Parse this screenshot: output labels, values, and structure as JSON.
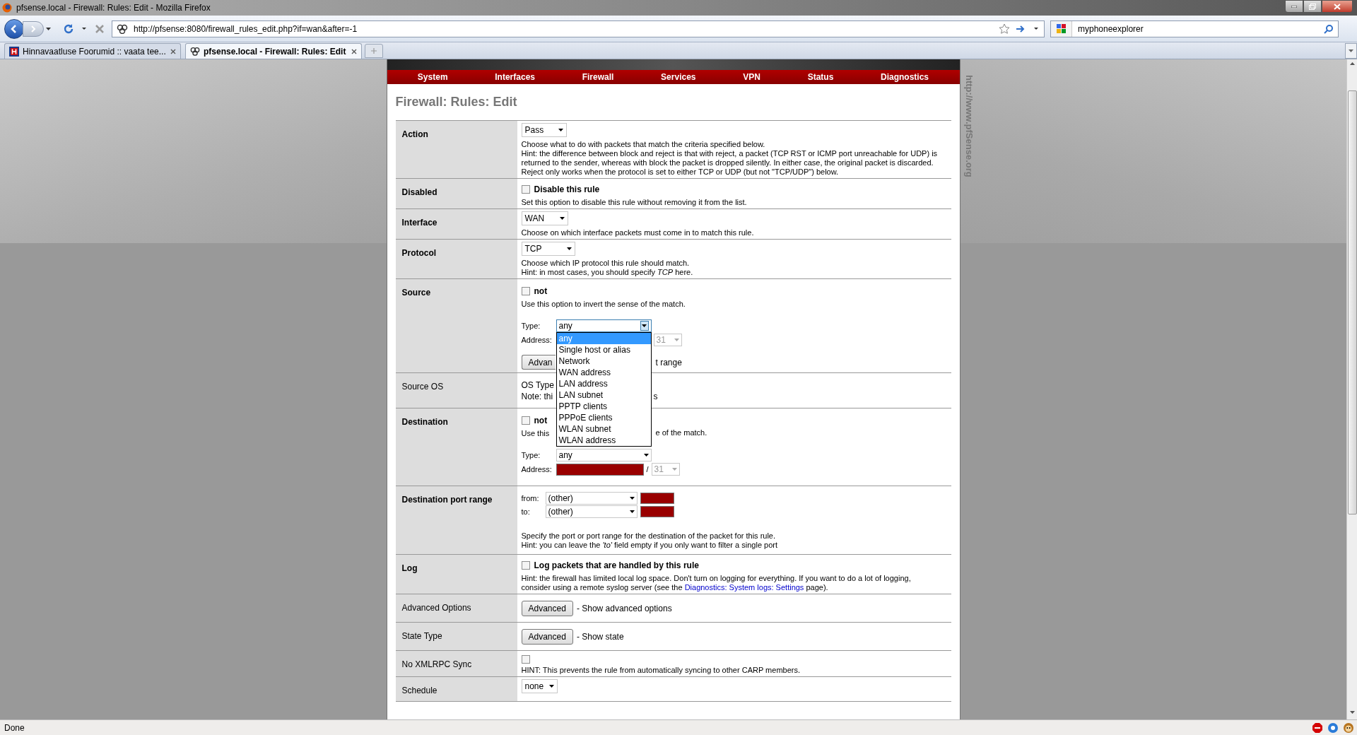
{
  "window": {
    "title": "pfsense.local - Firewall: Rules: Edit - Mozilla Firefox"
  },
  "toolbar": {
    "url": "http://pfsense:8080/firewall_rules_edit.php?if=wan&after=-1",
    "search": "myphoneexplorer"
  },
  "tabs": [
    {
      "label": "Hinnavaatluse Foorumid :: vaata tee...",
      "selected": false
    },
    {
      "label": "pfsense.local - Firewall: Rules: Edit",
      "selected": true
    }
  ],
  "page": {
    "nav": [
      "System",
      "Interfaces",
      "Firewall",
      "Services",
      "VPN",
      "Status",
      "Diagnostics"
    ],
    "side_text": "http://www.pfSense.org",
    "title": "Firewall: Rules: Edit",
    "rows": [
      {
        "kind": "select",
        "label": "Action",
        "bold": true,
        "select": "Pass",
        "text": [
          "Choose what to do with packets that match the criteria specified below.",
          "Hint: the difference between block and reject is that with reject, a packet (TCP RST or ICMP port unreachable for UDP) is",
          "returned to the sender, whereas with block the packet is dropped silently. In either case, the original packet is discarded.",
          "Reject only works when the protocol is set to either TCP or UDP (but not \"TCP/UDP\") below."
        ]
      },
      {
        "kind": "checkbox",
        "label": "Disabled",
        "bold": true,
        "checkbox": {
          "label": "Disable this rule",
          "checked": false
        },
        "text": [
          "Set this option to disable this rule without removing it from the list."
        ]
      },
      {
        "kind": "select",
        "label": "Interface",
        "bold": true,
        "select": "WAN",
        "text": [
          "Choose on which interface packets must come in to match this rule."
        ]
      },
      {
        "kind": "select",
        "label": "Protocol",
        "bold": true,
        "select": "TCP",
        "text": [
          "Choose which IP protocol this rule should match.",
          "Hint: in most cases, you should specify *TCP* here."
        ]
      },
      {
        "kind": "address",
        "label": "Source",
        "bold": true,
        "checkbox": {
          "label": "not",
          "checked": false
        },
        "hint": [
          "Use this option to invert the sense of the match."
        ],
        "type_label": "Type:",
        "type_value": "any",
        "address_label": "Address:",
        "mask": "31",
        "button": "Advan",
        "button_note": "t range",
        "dropdown": [
          {
            "label": "any",
            "selected": true
          },
          {
            "label": "Single host or alias",
            "selected": false
          },
          {
            "label": "Network",
            "selected": false
          },
          {
            "label": "WAN address",
            "selected": false
          },
          {
            "label": "LAN address",
            "selected": false
          },
          {
            "label": "LAN subnet",
            "selected": false
          },
          {
            "label": "PPTP clients",
            "selected": false
          },
          {
            "label": "PPPoE clients",
            "selected": false
          },
          {
            "label": "WLAN subnet",
            "selected": false
          },
          {
            "label": "WLAN address",
            "selected": false
          }
        ]
      },
      {
        "kind": "fragments",
        "label": "Source OS",
        "bold": false,
        "lines": [
          [
            "OS Type"
          ],
          [
            "Note: thi",
            "s"
          ]
        ]
      },
      {
        "kind": "address",
        "label": "Destination",
        "bold": true,
        "checkbox": {
          "label": "not",
          "checked": false
        },
        "hint": [
          "Use this",
          "e of the match."
        ],
        "type_label": "Type:",
        "type_value": "any",
        "address_label": "Address:",
        "separator": "/",
        "mask": "31"
      },
      {
        "kind": "ports",
        "label": "Destination port range",
        "bold": true,
        "ports": [
          {
            "label": "from:",
            "value": "(other)"
          },
          {
            "label": "to:",
            "value": "(other)"
          }
        ],
        "text": [
          "Specify the port or port range for the destination of the packet for this rule.",
          "Hint: you can leave the *'to'* field empty if you only want to filter a single port"
        ]
      },
      {
        "kind": "checkbox",
        "label": "Log",
        "bold": true,
        "checkbox": {
          "label": "Log packets that are handled by this rule",
          "checked": false
        },
        "text": [
          "Hint: the firewall has limited local log space. Don't turn on logging for everything. If you want to do a lot of logging,"
        ],
        "link_line": {
          "before": "consider using a remote syslog server (see the",
          "link": "Diagnostics: System logs: Settings",
          "after": "page)."
        }
      },
      {
        "kind": "button",
        "label": "Advanced Options",
        "bold": false,
        "button": "Advanced",
        "note": "- Show advanced options"
      },
      {
        "kind": "button",
        "label": "State Type",
        "bold": false,
        "button": "Advanced",
        "note": "- Show state"
      },
      {
        "kind": "checkbox",
        "label": "No XMLRPC Sync",
        "bold": false,
        "checkbox": {
          "checked": false
        },
        "text": [
          "HINT: This prevents the rule from automatically syncing to other CARP members."
        ]
      },
      {
        "kind": "select",
        "label": "Schedule",
        "bold": false,
        "select": "none",
        "text": []
      }
    ]
  },
  "status_bar": {
    "text": "Done"
  }
}
